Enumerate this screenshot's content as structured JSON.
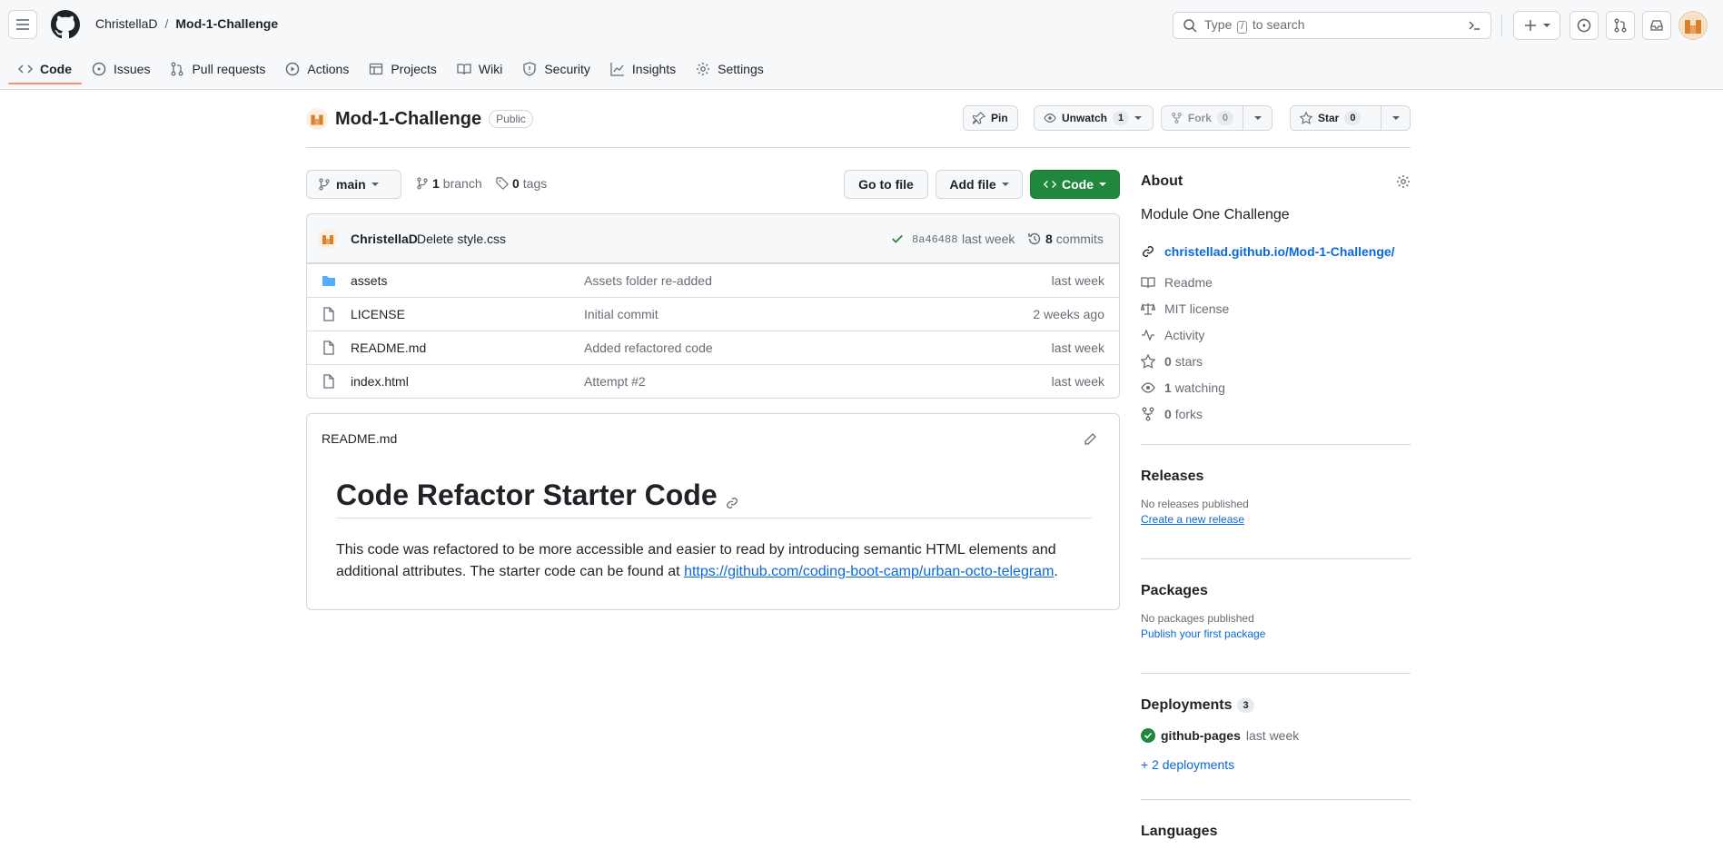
{
  "header": {
    "owner": "ChristellaD",
    "separator": "/",
    "repo": "Mod-1-Challenge",
    "search_prefix": "Type",
    "search_key": "/",
    "search_suffix": "to search"
  },
  "tabs": [
    {
      "label": "Code"
    },
    {
      "label": "Issues"
    },
    {
      "label": "Pull requests"
    },
    {
      "label": "Actions"
    },
    {
      "label": "Projects"
    },
    {
      "label": "Wiki"
    },
    {
      "label": "Security"
    },
    {
      "label": "Insights"
    },
    {
      "label": "Settings"
    }
  ],
  "repo": {
    "name": "Mod-1-Challenge",
    "visibility": "Public",
    "pin": "Pin",
    "unwatch": "Unwatch",
    "unwatch_count": "1",
    "fork": "Fork",
    "fork_count": "0",
    "star": "Star",
    "star_count": "0"
  },
  "toolbar": {
    "branch": "main",
    "branch_count": "1",
    "branch_label": "branch",
    "tag_count": "0",
    "tag_label": "tags",
    "goto": "Go to file",
    "add": "Add file",
    "code": "Code"
  },
  "commit": {
    "author": "ChristellaD",
    "message": "Delete style.css",
    "sha": "8a46488",
    "time": "last week",
    "count": "8",
    "count_label": "commits"
  },
  "files": [
    {
      "name": "assets",
      "message": "Assets folder re-added",
      "age": "last week",
      "type": "folder"
    },
    {
      "name": "LICENSE",
      "message": "Initial commit",
      "age": "2 weeks ago",
      "type": "file"
    },
    {
      "name": "README.md",
      "message": "Added refactored code",
      "age": "last week",
      "type": "file"
    },
    {
      "name": "index.html",
      "message": "Attempt #2",
      "age": "last week",
      "type": "file"
    }
  ],
  "readme": {
    "filename": "README.md",
    "title": "Code Refactor Starter Code",
    "body1": "This code was refactored to be more accessible and easier to read by introducing semantic HTML elements and additional attributes. The starter code can be found at",
    "link": "https://github.com/coding-boot-camp/urban-octo-telegram",
    "body2": "."
  },
  "about": {
    "heading": "About",
    "description": "Module One Challenge",
    "website": "christellad.github.io/Mod-1-Challenge/",
    "readme": "Readme",
    "license": "MIT license",
    "activity": "Activity",
    "stars": "0",
    "stars_label": "stars",
    "watching": "1",
    "watching_label": "watching",
    "forks": "0",
    "forks_label": "forks"
  },
  "releases": {
    "heading": "Releases",
    "none": "No releases published",
    "create": "Create a new release"
  },
  "packages": {
    "heading": "Packages",
    "none": "No packages published",
    "publish": "Publish your first package"
  },
  "deployments": {
    "heading": "Deployments",
    "count": "3",
    "name": "github-pages",
    "time": "last week",
    "more": "+ 2 deployments"
  },
  "languages": {
    "heading": "Languages"
  },
  "colors": {
    "accent": "#0969da",
    "green": "#1f883d",
    "tab_underline": "#fd8c73",
    "border": "#d0d7de"
  }
}
